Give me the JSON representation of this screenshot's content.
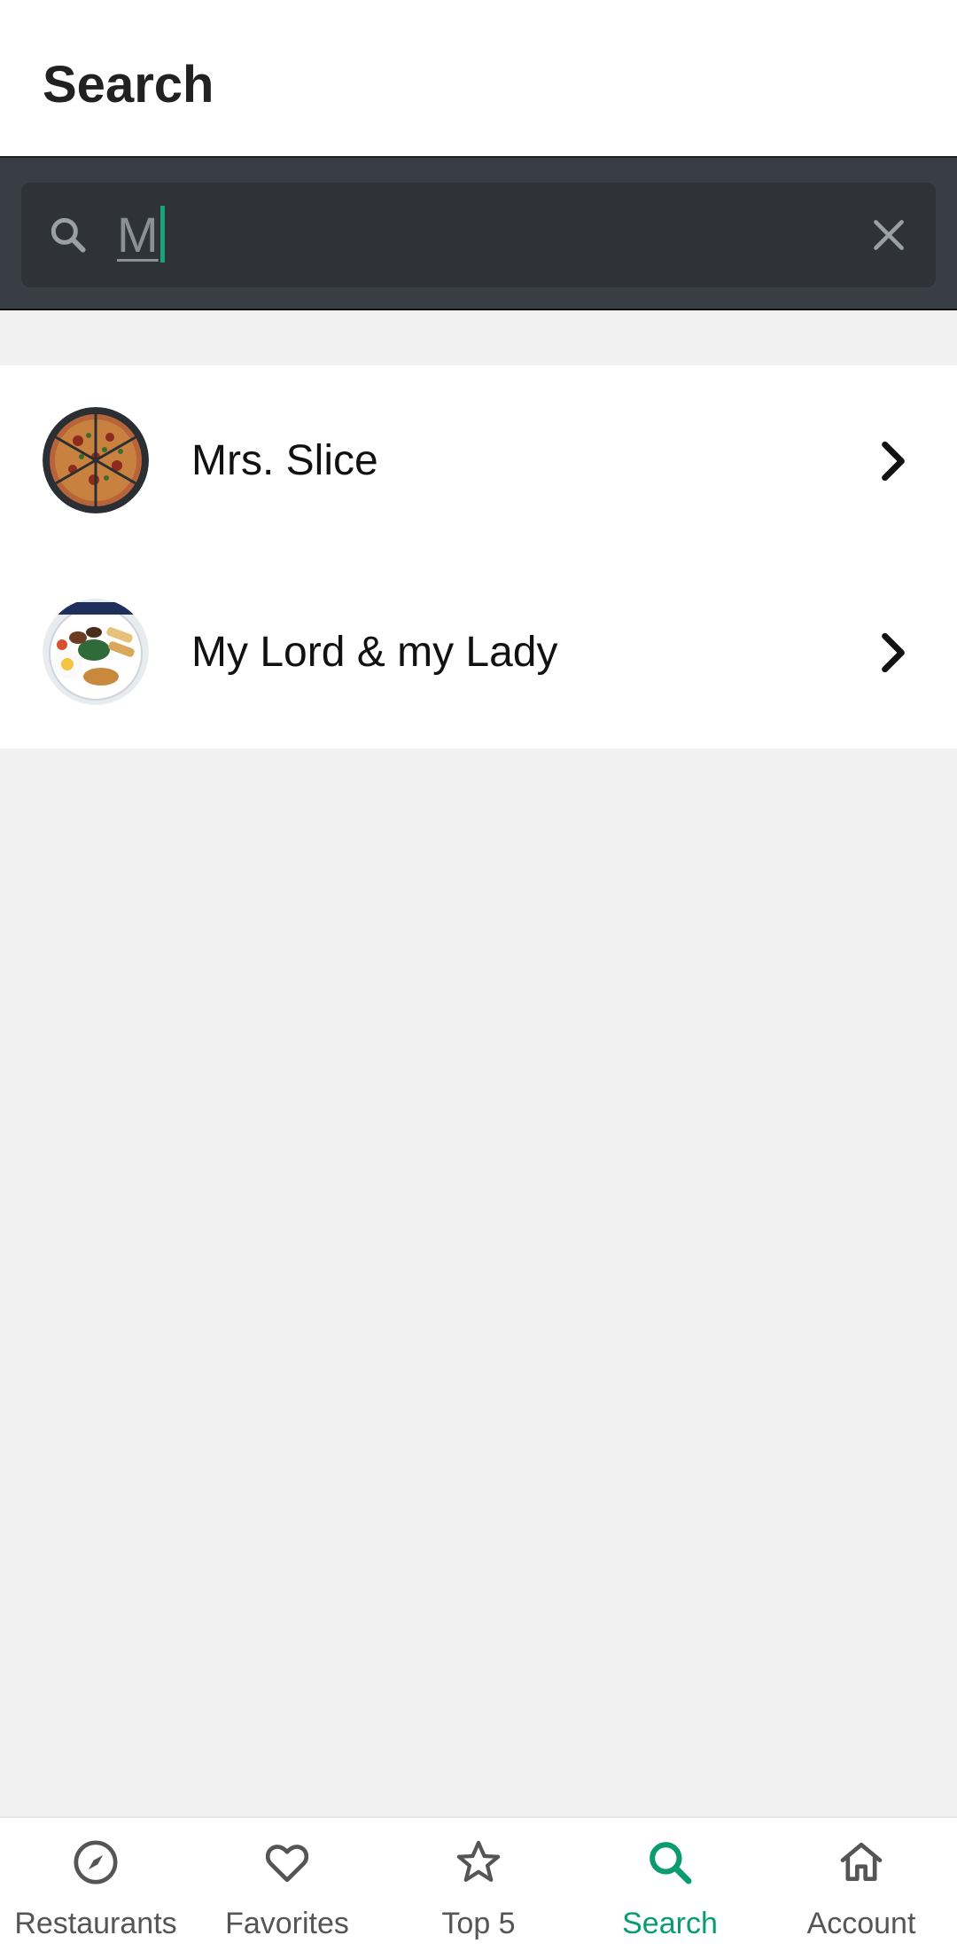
{
  "header": {
    "title": "Search"
  },
  "search": {
    "query": "M",
    "search_icon": "search-icon",
    "clear_icon": "close-icon"
  },
  "results": [
    {
      "name": "Mrs. Slice",
      "thumbnail": "pizza-photo"
    },
    {
      "name": "My Lord & my Lady",
      "thumbnail": "breakfast-plate-photo"
    }
  ],
  "nav": {
    "items": [
      {
        "label": "Restaurants",
        "icon": "compass-icon"
      },
      {
        "label": "Favorites",
        "icon": "heart-icon"
      },
      {
        "label": "Top 5",
        "icon": "star-icon"
      },
      {
        "label": "Search",
        "icon": "search-icon"
      },
      {
        "label": "Account",
        "icon": "home-icon"
      }
    ],
    "active": "Search"
  },
  "colors": {
    "accent": "#0a9b6f",
    "search_band": "#393e46",
    "search_box": "#2f3238",
    "caret": "#1aa37a"
  }
}
